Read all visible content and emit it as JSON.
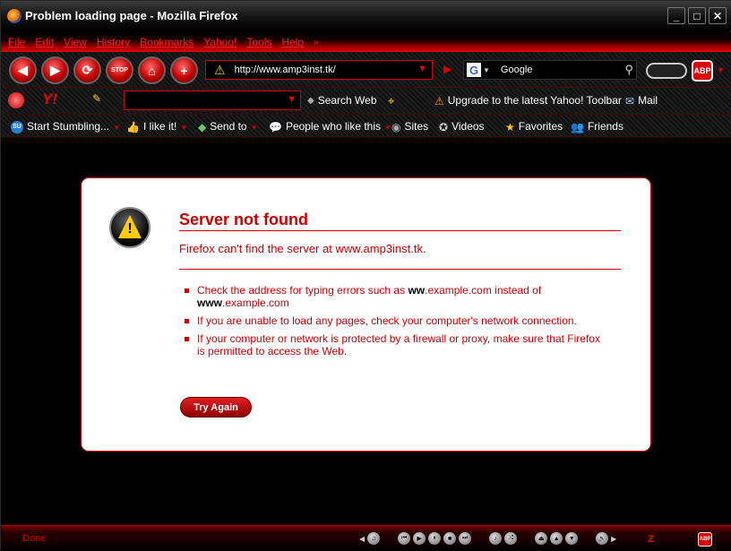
{
  "window": {
    "title": "Problem loading page - Mozilla Firefox"
  },
  "menu": {
    "items": [
      "File",
      "Edit",
      "View",
      "History",
      "Bookmarks",
      "Yahoo!",
      "Tools",
      "Help"
    ],
    "more": "»"
  },
  "navbar": {
    "url": "http://www.amp3inst.tk/",
    "search_engine": "Google",
    "stop_label": "STOP",
    "abp_label": "ABP"
  },
  "yahoo_toolbar": {
    "search_web": "Search Web",
    "upgrade": "Upgrade to the latest Yahoo! Toolbar",
    "mail": "Mail"
  },
  "stumble_toolbar": {
    "su_label": "SU",
    "start": "Start Stumbling...",
    "like": "I like it!",
    "send": "Send to",
    "people": "People who like this",
    "sites": "Sites",
    "videos": "Videos",
    "favorites": "Favorites",
    "friends": "Friends"
  },
  "error": {
    "title": "Server not found",
    "subtitle": "Firefox can't find the server at www.amp3inst.tk.",
    "bullet1_pre": "Check the address for typing errors such as ",
    "bullet1_b1": "ww",
    "bullet1_mid": ".example.com instead of ",
    "bullet1_b2": "www",
    "bullet1_post": ".example.com",
    "bullet2": "If you are unable to load any pages, check your computer's network connection.",
    "bullet3": "If your computer or network is protected by a firewall or proxy, make sure that Firefox is permitted to access the Web.",
    "try_again": "Try Again"
  },
  "status": {
    "text": "Done",
    "abp": "ABP",
    "zlogo": "Z"
  },
  "colors": {
    "accent": "#cc0000",
    "background": "#000000",
    "panel": "#ffffff"
  }
}
